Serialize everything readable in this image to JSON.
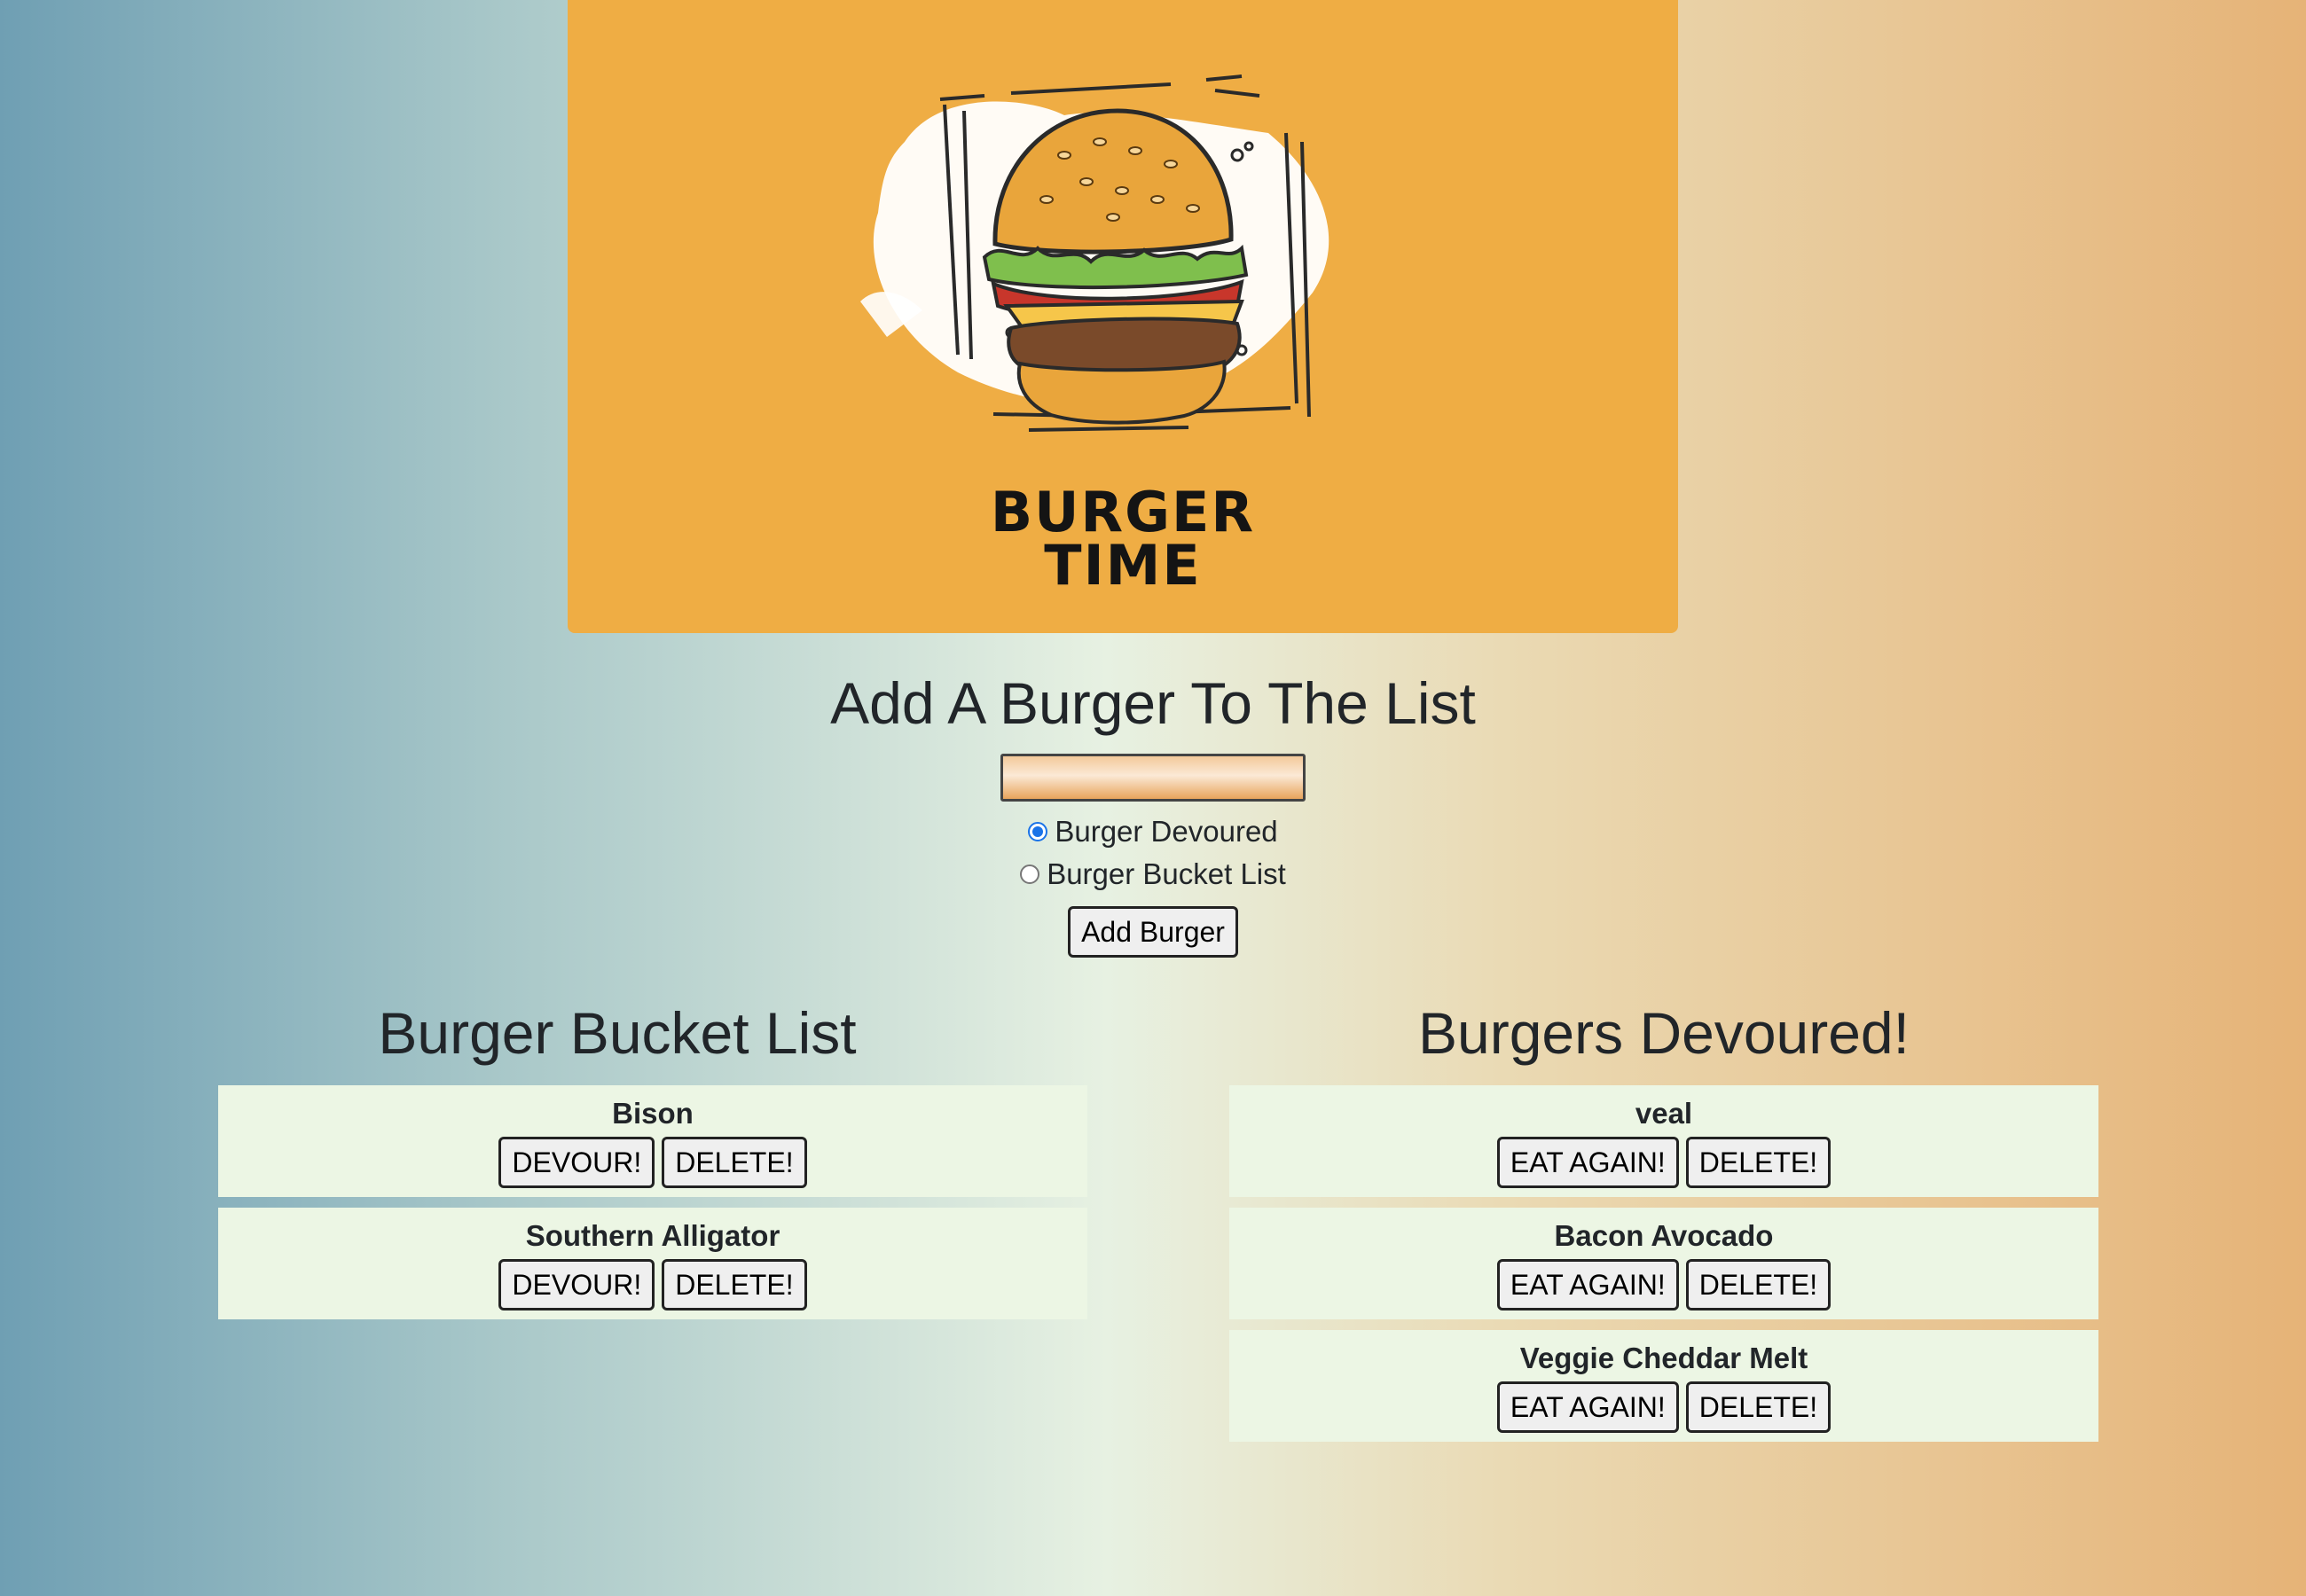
{
  "banner": {
    "title_line1": "BURGER",
    "title_line2": "TIME"
  },
  "add_form": {
    "heading": "Add A Burger To The List",
    "input_value": "",
    "input_placeholder": "",
    "radio_devoured_label": "Burger Devoured",
    "radio_bucket_label": "Burger Bucket List",
    "selected_option": "Burger Devoured",
    "submit_label": "Add Burger"
  },
  "bucket_list": {
    "heading": "Burger Bucket List",
    "items": [
      {
        "name": "Bison",
        "primary_label": "DEVOUR!",
        "delete_label": "DELETE!"
      },
      {
        "name": "Southern Alligator",
        "primary_label": "DEVOUR!",
        "delete_label": "DELETE!"
      }
    ]
  },
  "devoured": {
    "heading": "Burgers Devoured!",
    "items": [
      {
        "name": "veal",
        "primary_label": "EAT AGAIN!",
        "delete_label": "DELETE!"
      },
      {
        "name": "Bacon Avocado",
        "primary_label": "EAT AGAIN!",
        "delete_label": "DELETE!"
      },
      {
        "name": "Veggie Cheddar Melt",
        "primary_label": "EAT AGAIN!",
        "delete_label": "DELETE!"
      }
    ]
  },
  "colors": {
    "banner_bg": "#efad44",
    "card_bg": "#ecf6e4",
    "radio_accent": "#1a73e8"
  }
}
